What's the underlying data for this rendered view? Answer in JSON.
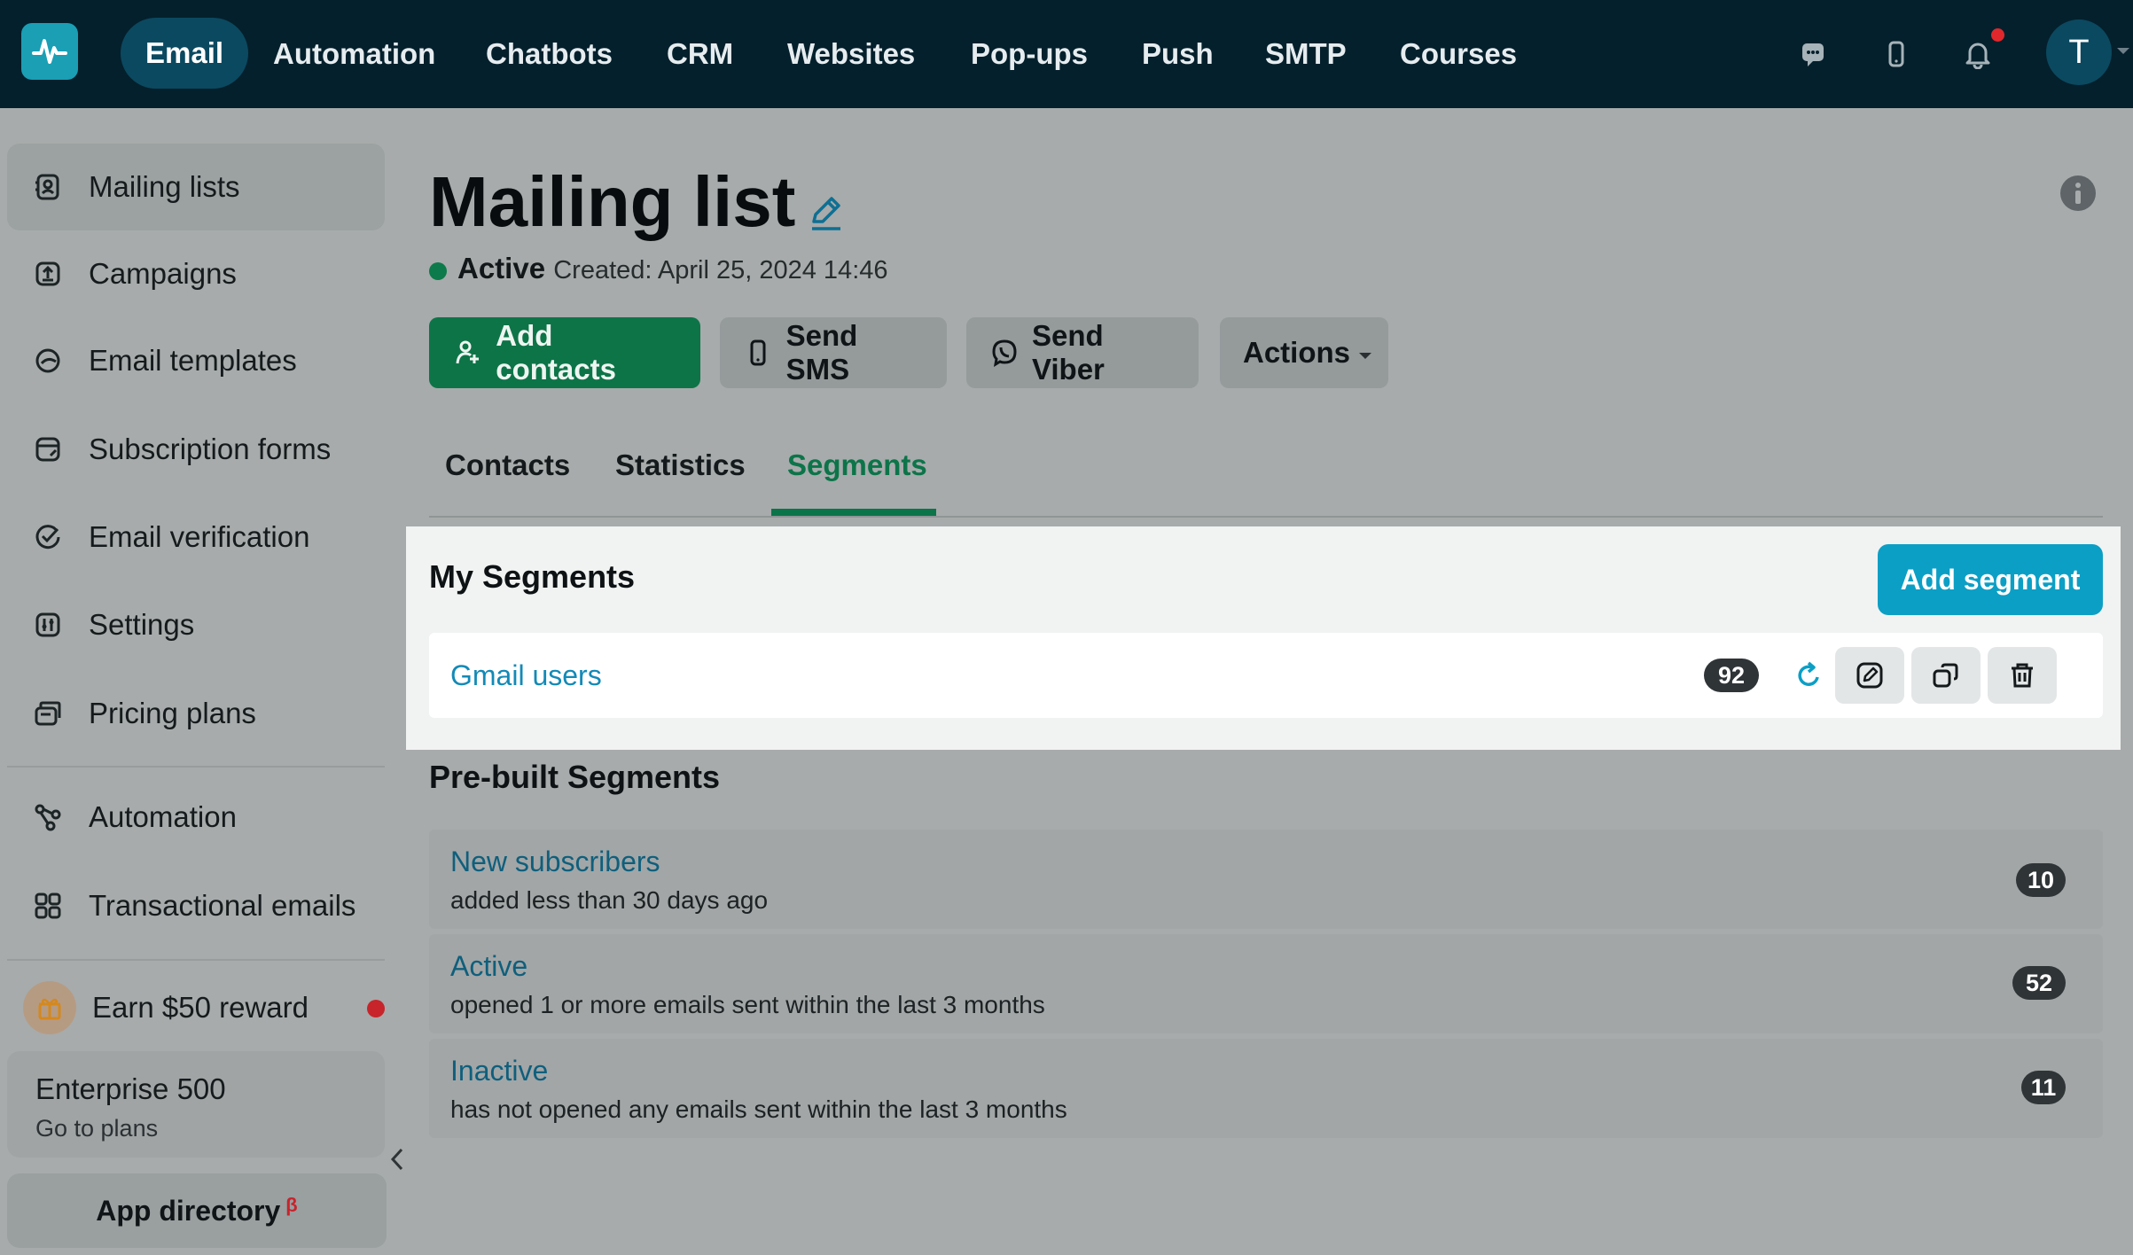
{
  "topnav": {
    "items": [
      "Email",
      "Automation",
      "Chatbots",
      "CRM",
      "Websites",
      "Pop-ups",
      "Push",
      "SMTP",
      "Courses"
    ],
    "active": "Email",
    "avatar_letter": "T"
  },
  "sidebar": {
    "items": [
      {
        "label": "Mailing lists",
        "icon": "contacts-icon",
        "active": true
      },
      {
        "label": "Campaigns",
        "icon": "upload-icon"
      },
      {
        "label": "Email templates",
        "icon": "template-icon"
      },
      {
        "label": "Subscription forms",
        "icon": "form-icon"
      },
      {
        "label": "Email verification",
        "icon": "check-circle-icon"
      },
      {
        "label": "Settings",
        "icon": "sliders-icon"
      },
      {
        "label": "Pricing plans",
        "icon": "wallet-icon"
      },
      {
        "label": "Automation",
        "icon": "flow-icon"
      },
      {
        "label": "Transactional emails",
        "icon": "grid-icon"
      }
    ],
    "reward": "Earn $50 reward",
    "plan": {
      "name": "Enterprise 500",
      "link": "Go to plans"
    },
    "app_directory": "App directory",
    "beta": "β"
  },
  "header": {
    "title": "Mailing list",
    "status": "Active",
    "created": "Created: April 25, 2024 14:46"
  },
  "actions": {
    "add_contacts": "Add contacts",
    "send_sms": "Send SMS",
    "send_viber": "Send Viber",
    "actions": "Actions"
  },
  "tabs": [
    "Contacts",
    "Statistics",
    "Segments"
  ],
  "active_tab": "Segments",
  "my_segments": {
    "title": "My Segments",
    "add_button": "Add segment",
    "rows": [
      {
        "name": "Gmail users",
        "count": "92"
      }
    ]
  },
  "prebuilt": {
    "title": "Pre-built Segments",
    "rows": [
      {
        "name": "New subscribers",
        "desc": "added less than 30 days ago",
        "count": "10"
      },
      {
        "name": "Active",
        "desc": "opened 1 or more emails sent within the last 3 months",
        "count": "52"
      },
      {
        "name": "Inactive",
        "desc": "has not opened any emails sent within the last 3 months",
        "count": "11"
      }
    ]
  },
  "colors": {
    "topbar": "#04202c",
    "primary_green": "#0d7448",
    "accent_blue": "#0c9fc5",
    "link_blue": "#138ab7"
  }
}
